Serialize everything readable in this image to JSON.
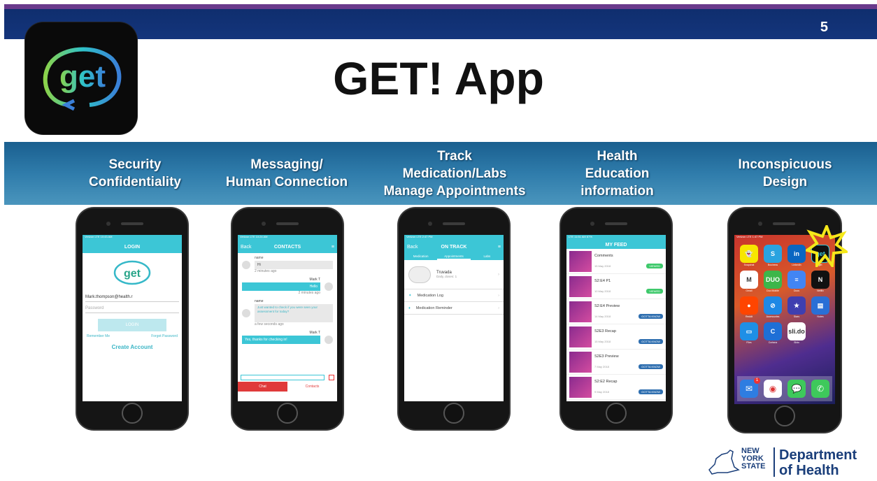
{
  "slide_number": "5",
  "title": "GET! App",
  "logo_text": "get",
  "features": [
    {
      "label": "Security\nConfidentiality"
    },
    {
      "label": "Messaging/\nHuman Connection"
    },
    {
      "label": "Track\nMedication/Labs\nManage Appointments"
    },
    {
      "label": "Health\nEducation\ninformation"
    },
    {
      "label": "Inconspicuous\nDesign"
    }
  ],
  "phone1": {
    "status": "Verizon LTE  10:43 AM",
    "header": "LOGIN",
    "logo": "get",
    "email": "Mark.thompson@health.r",
    "password_placeholder": "Password",
    "login_button": "LOGIN",
    "remember": "Remember Me",
    "forgot": "Forgot Password",
    "create_account": "Create Account"
  },
  "phone2": {
    "status": "Verizon LTE  10:24 AM",
    "back": "Back",
    "header": "CONTACTS",
    "messages": [
      {
        "side": "left",
        "name": "name",
        "text": "Hi",
        "time": "2 minutes ago"
      },
      {
        "side": "right",
        "name": "Mark T",
        "text": "Hello",
        "time": "2 minutes ago"
      },
      {
        "side": "left",
        "name": "name",
        "text": "Just wanted to check if you were seen your assessment for today?",
        "time": "a few seconds ago"
      },
      {
        "side": "right",
        "name": "Mark T",
        "text": "Yes, thanks for checking in!",
        "time": ""
      }
    ],
    "tab_chat": "Chat",
    "tab_contacts": "Contacts"
  },
  "phone3": {
    "status": "Verizon LTE  2:47 PM",
    "back": "Back",
    "header": "ON TRACK",
    "tabs": [
      "Medication",
      "Appointments",
      "Labs"
    ],
    "med_name": "Truvada",
    "med_detail": "Daily, doses: 1",
    "rows": [
      "Medication Log",
      "Medication Reminder"
    ]
  },
  "phone4": {
    "status": "LTE  11:51 AM  87%",
    "header": "MY FEED",
    "items": [
      {
        "title": "Comments",
        "date": "15 May 2018",
        "badge": "VIEWED"
      },
      {
        "title": "S2:E4 P1",
        "date": "10 May 2018",
        "badge": "VIEWED"
      },
      {
        "title": "S2:E4 Preview",
        "date": "14 May 2018",
        "badge": "GOTTA KNOW"
      },
      {
        "title": "S2E3 Recap",
        "date": "15 May 2018",
        "badge": "GOTTA KNOW"
      },
      {
        "title": "S2E3 Preview",
        "date": "7 May 2018",
        "badge": "GOTTA KNOW"
      },
      {
        "title": "S2:E2 Recap",
        "date": "9 May 2018",
        "badge": "GOTTA KNOW"
      }
    ]
  },
  "phone5": {
    "status": "Verizon LTE  1:47 PM",
    "apps": [
      {
        "label": "Snapchat",
        "color": "#f7e600",
        "glyph": "👻"
      },
      {
        "label": "Business",
        "color": "#2aa3e0",
        "glyph": "S"
      },
      {
        "label": "LinkedIn",
        "color": "#0a66c2",
        "glyph": "in"
      },
      {
        "label": "get",
        "color": "#111111",
        "glyph": "get"
      },
      {
        "label": "Gmail",
        "color": "#ffffff",
        "glyph": "M"
      },
      {
        "label": "Duo Mobile",
        "color": "#3cb64a",
        "glyph": "DUO"
      },
      {
        "label": "Docs",
        "color": "#4285f4",
        "glyph": "≡"
      },
      {
        "label": "Netflix",
        "color": "#111111",
        "glyph": "N"
      },
      {
        "label": "Reddit",
        "color": "#ff4500",
        "glyph": "●"
      },
      {
        "label": "Accessories",
        "color": "#1e88e5",
        "glyph": "⊘"
      },
      {
        "label": "Stars",
        "color": "#3f3fb0",
        "glyph": "★"
      },
      {
        "label": "Notes",
        "color": "#2a6fd6",
        "glyph": "▤"
      },
      {
        "label": "Files",
        "color": "#1e8fe6",
        "glyph": "▭"
      },
      {
        "label": "Cortana",
        "color": "#1e6fd6",
        "glyph": "C"
      },
      {
        "label": "Slido",
        "color": "#ffffff",
        "glyph": "sli.do"
      }
    ],
    "dock": [
      {
        "label": "Mail",
        "color": "#2e7de1",
        "glyph": "✉",
        "badge": "1"
      },
      {
        "label": "Chrome",
        "color": "#ffffff",
        "glyph": "◉",
        "badge": ""
      },
      {
        "label": "Messages",
        "color": "#3ec95b",
        "glyph": "💬",
        "badge": ""
      },
      {
        "label": "Phone",
        "color": "#3ec95b",
        "glyph": "✆",
        "badge": ""
      }
    ]
  },
  "nys": {
    "state_line1": "NEW",
    "state_line2": "YORK",
    "state_line3": "STATE",
    "dept_line1": "Department",
    "dept_line2": "of Health"
  },
  "colors": {
    "top_purple": "#6a3a8c",
    "top_navy": "#14357c",
    "band": "#2f7cab",
    "app_teal": "#3cc6d6",
    "highlight_star": "#f5e81a"
  }
}
